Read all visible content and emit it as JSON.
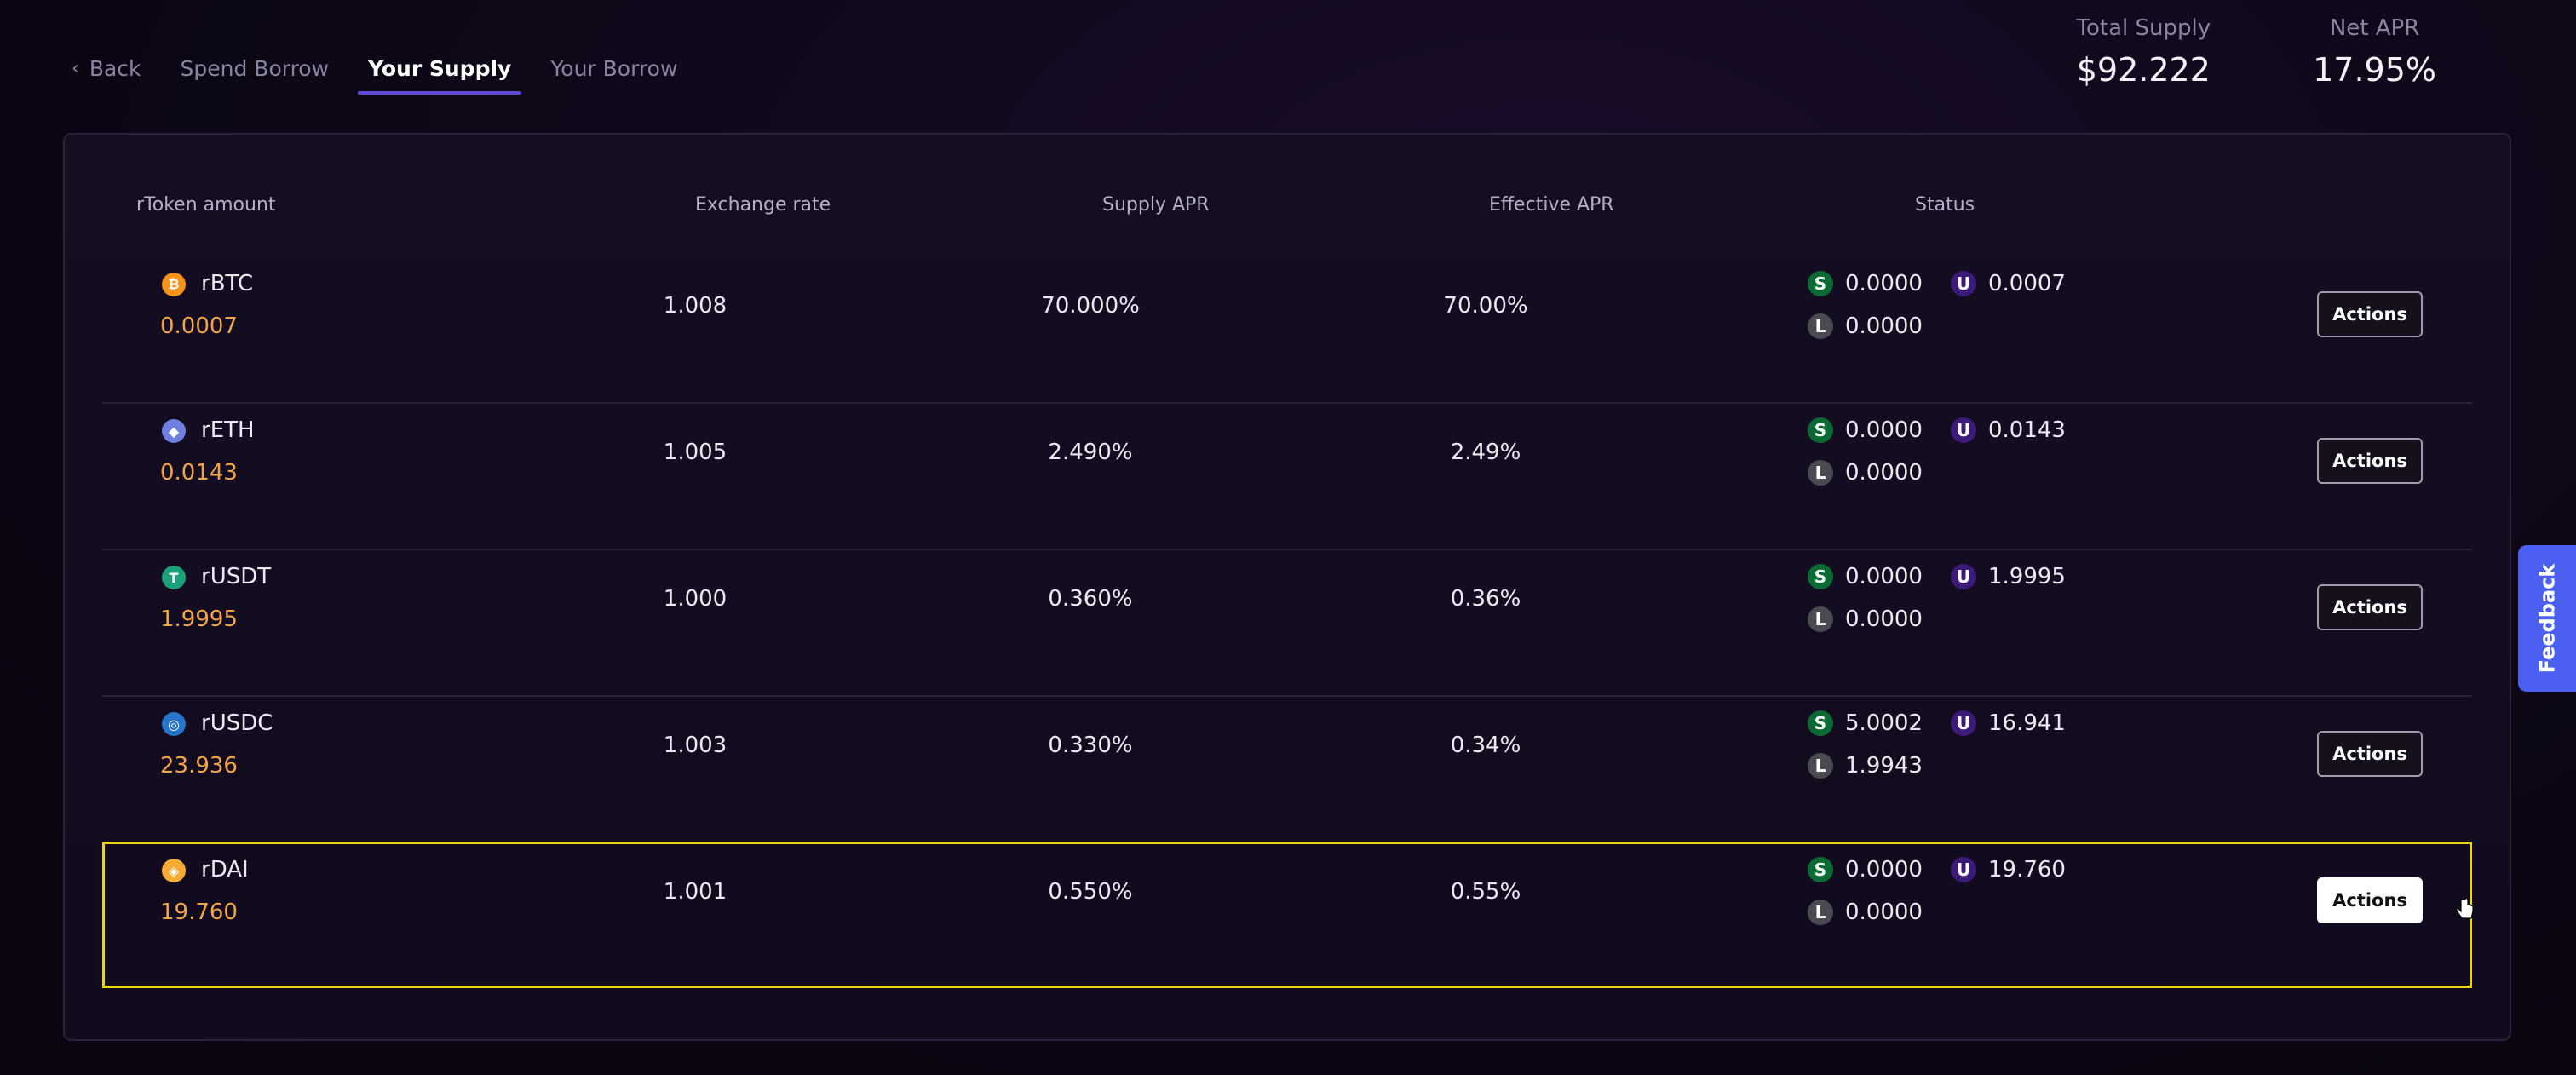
{
  "nav": {
    "back_label": "Back",
    "tabs": [
      {
        "label": "Spend Borrow"
      },
      {
        "label": "Your Supply"
      },
      {
        "label": "Your Borrow"
      }
    ],
    "active_tab": "Your Supply"
  },
  "summary": {
    "total_supply_label": "Total Supply",
    "total_supply_value": "$92.222",
    "net_apr_label": "Net APR",
    "net_apr_value": "17.95%"
  },
  "table": {
    "headers": [
      "rToken amount",
      "Exchange rate",
      "Supply APR",
      "Effective APR",
      "Status"
    ],
    "rows": [
      {
        "token": "rBTC",
        "icon": "bitcoin-icon",
        "icon_color": "#f7931a",
        "icon_glyph": "₿",
        "amount": "0.0007",
        "exchange_rate": "1.008",
        "supply_apr": "70.000%",
        "effective_apr": "70.00%",
        "status_s": "0.0000",
        "status_u": "0.0007",
        "status_l": "0.0000",
        "action": "Actions"
      },
      {
        "token": "rETH",
        "icon": "ethereum-icon",
        "icon_color": "#6f7fe0",
        "icon_glyph": "◆",
        "amount": "0.0143",
        "exchange_rate": "1.005",
        "supply_apr": "2.490%",
        "effective_apr": "2.49%",
        "status_s": "0.0000",
        "status_u": "0.0143",
        "status_l": "0.0000",
        "action": "Actions"
      },
      {
        "token": "rUSDT",
        "icon": "tether-icon",
        "icon_color": "#1ba27a",
        "icon_glyph": "T",
        "amount": "1.9995",
        "exchange_rate": "1.000",
        "supply_apr": "0.360%",
        "effective_apr": "0.36%",
        "status_s": "0.0000",
        "status_u": "1.9995",
        "status_l": "0.0000",
        "action": "Actions"
      },
      {
        "token": "rUSDC",
        "icon": "usdc-icon",
        "icon_color": "#2775ca",
        "icon_glyph": "◎",
        "amount": "23.936",
        "exchange_rate": "1.003",
        "supply_apr": "0.330%",
        "effective_apr": "0.34%",
        "status_s": "5.0002",
        "status_u": "16.941",
        "status_l": "1.9943",
        "action": "Actions"
      },
      {
        "token": "rDAI",
        "icon": "dai-icon",
        "icon_color": "#f5ac37",
        "icon_glyph": "◈",
        "amount": "19.760",
        "exchange_rate": "1.001",
        "supply_apr": "0.550%",
        "effective_apr": "0.55%",
        "status_s": "0.0000",
        "status_u": "19.760",
        "status_l": "0.0000",
        "action": "Actions"
      }
    ]
  },
  "status_badges": {
    "s": "S",
    "u": "U",
    "l": "L"
  },
  "feedback_label": "Feedback",
  "colors": {
    "accent": "#5d4bd8",
    "amount": "#f2a546",
    "highlight": "#e6d71a",
    "feedback": "#4b5ff0"
  }
}
